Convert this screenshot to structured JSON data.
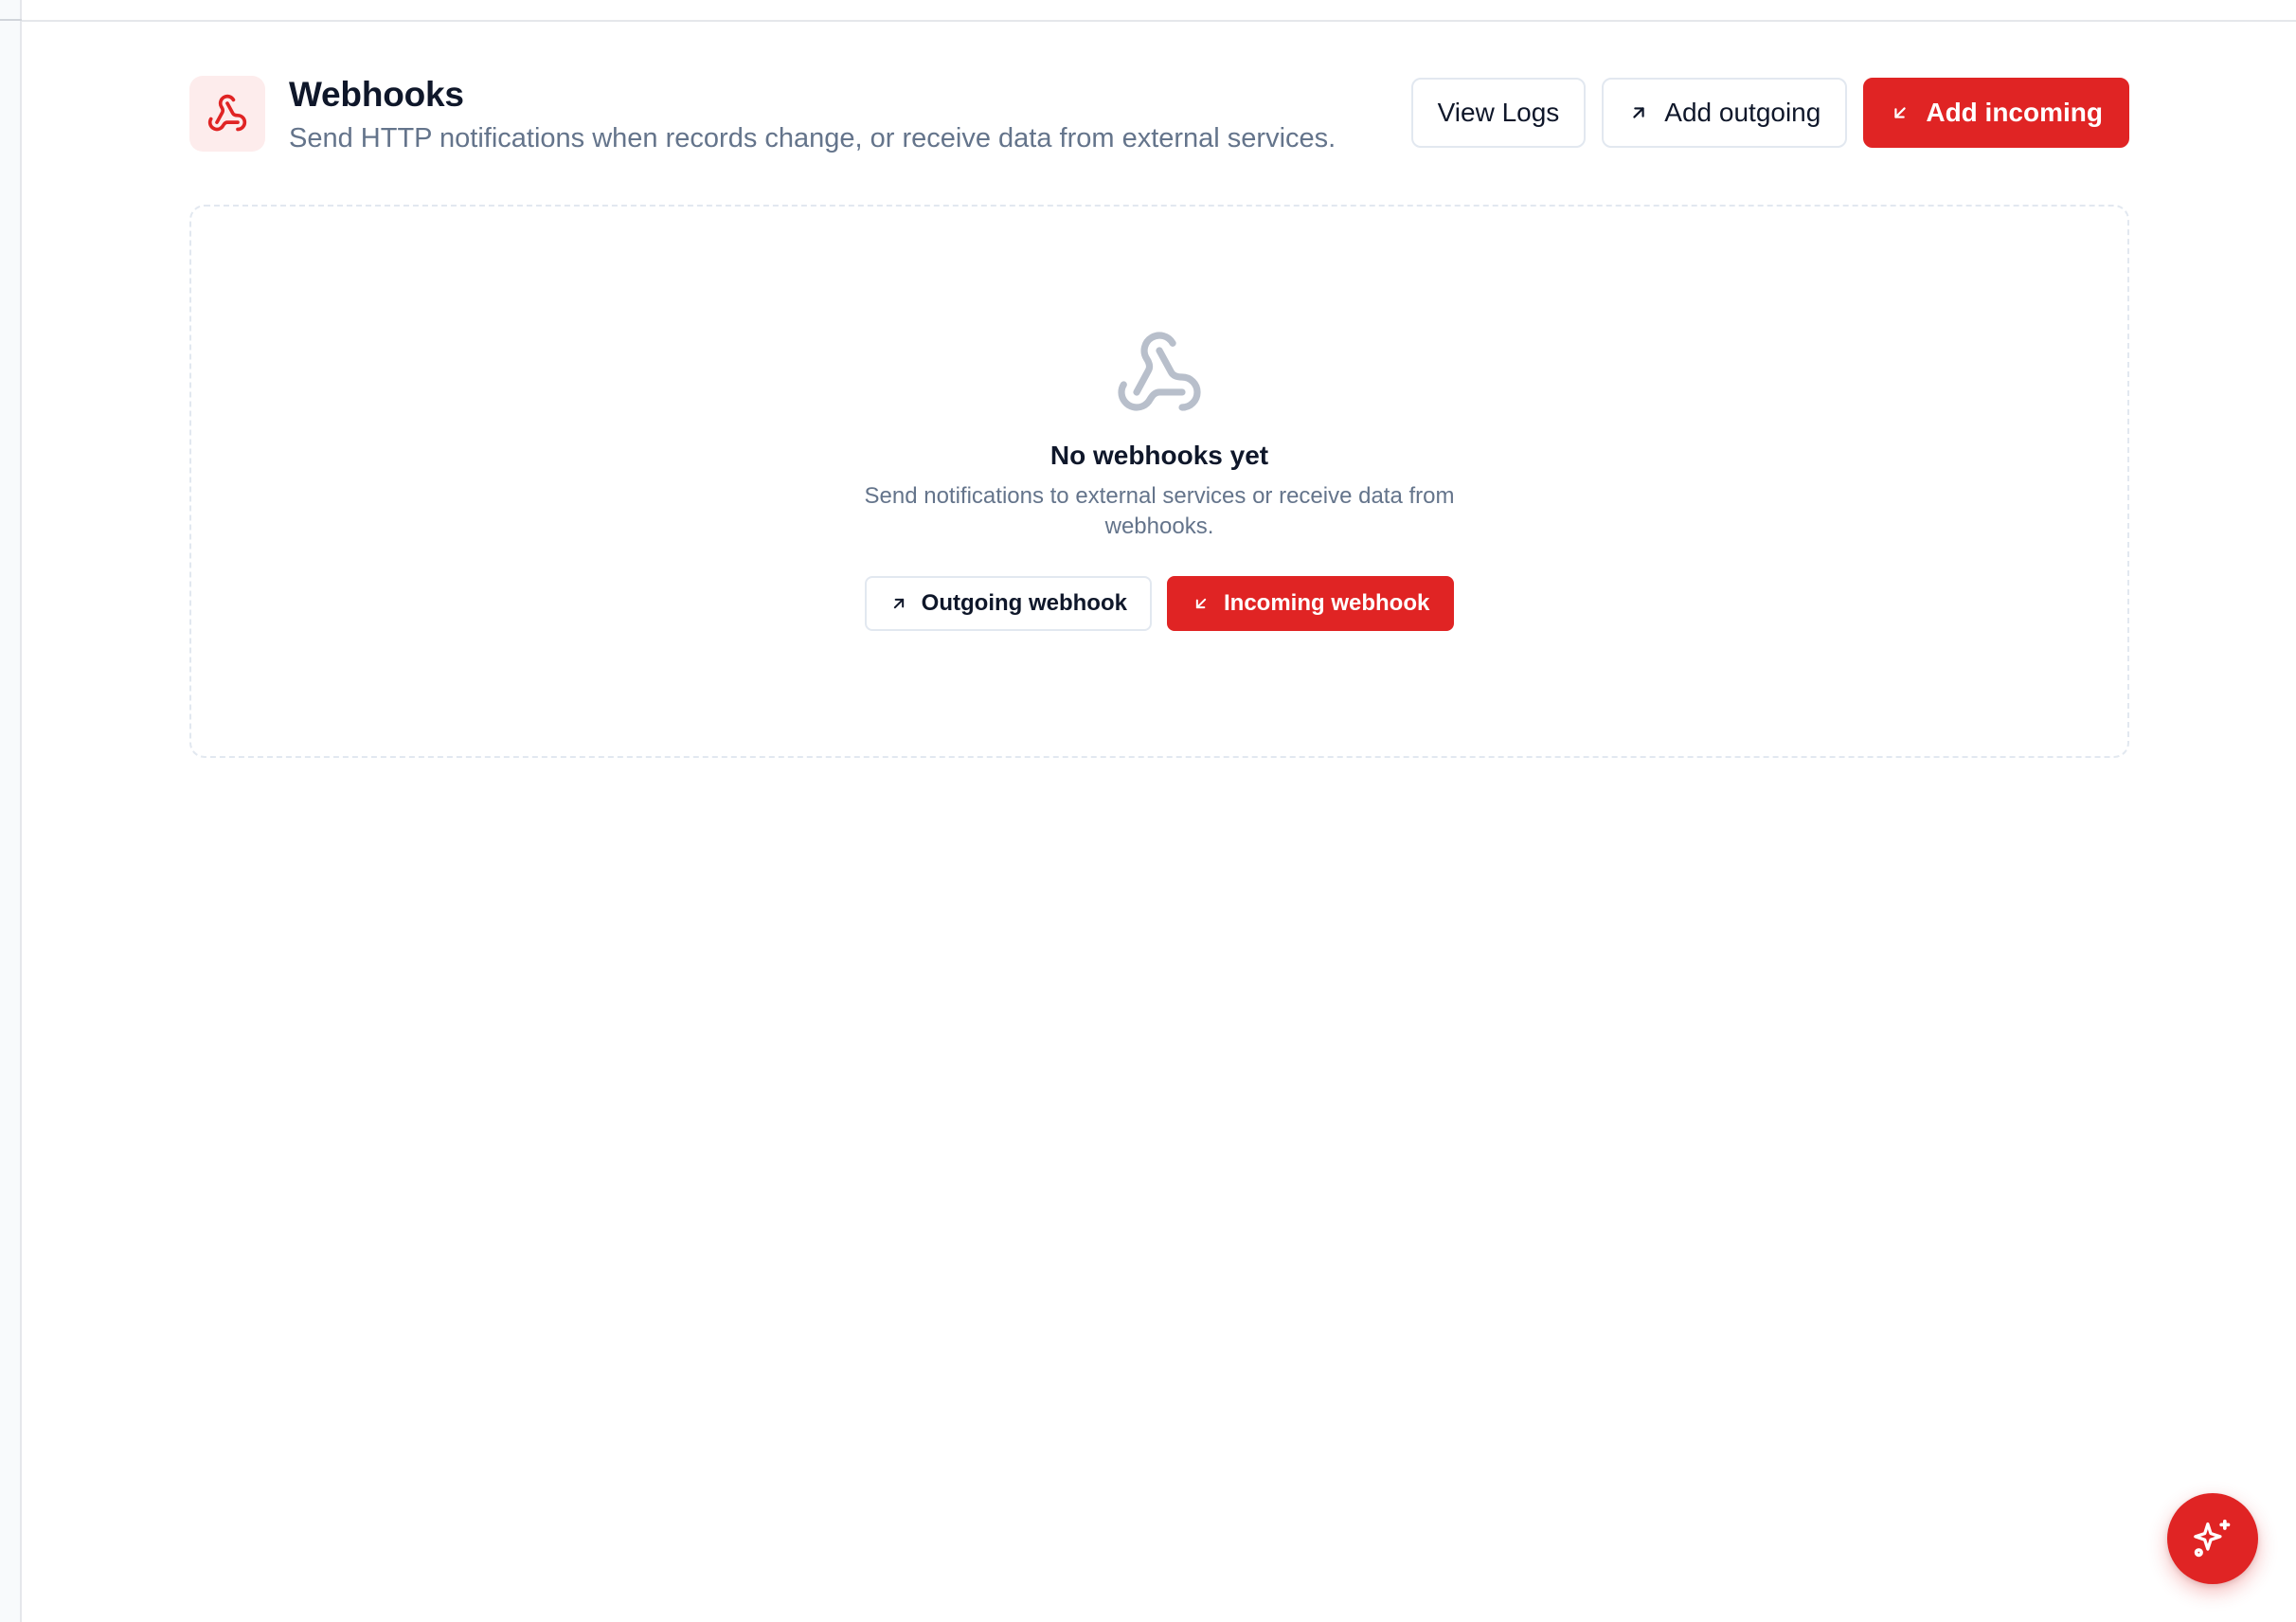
{
  "header": {
    "title": "Webhooks",
    "subtitle": "Send HTTP notifications when records change, or receive data from external services.",
    "icon": "webhook-icon",
    "actions": {
      "view_logs_label": "View Logs",
      "add_outgoing_label": "Add outgoing",
      "add_incoming_label": "Add incoming"
    }
  },
  "empty_state": {
    "icon": "webhook-icon",
    "title": "No webhooks yet",
    "description": "Send notifications to external services or receive data from webhooks.",
    "outgoing_label": "Outgoing webhook",
    "incoming_label": "Incoming webhook"
  },
  "fab": {
    "icon": "sparkles-icon"
  },
  "colors": {
    "accent": "#e02424",
    "accent_soft": "#fdecec",
    "text": "#0f172a",
    "muted": "#64748b",
    "border": "#e2e8f0",
    "icon_muted": "#b8bfcb"
  }
}
